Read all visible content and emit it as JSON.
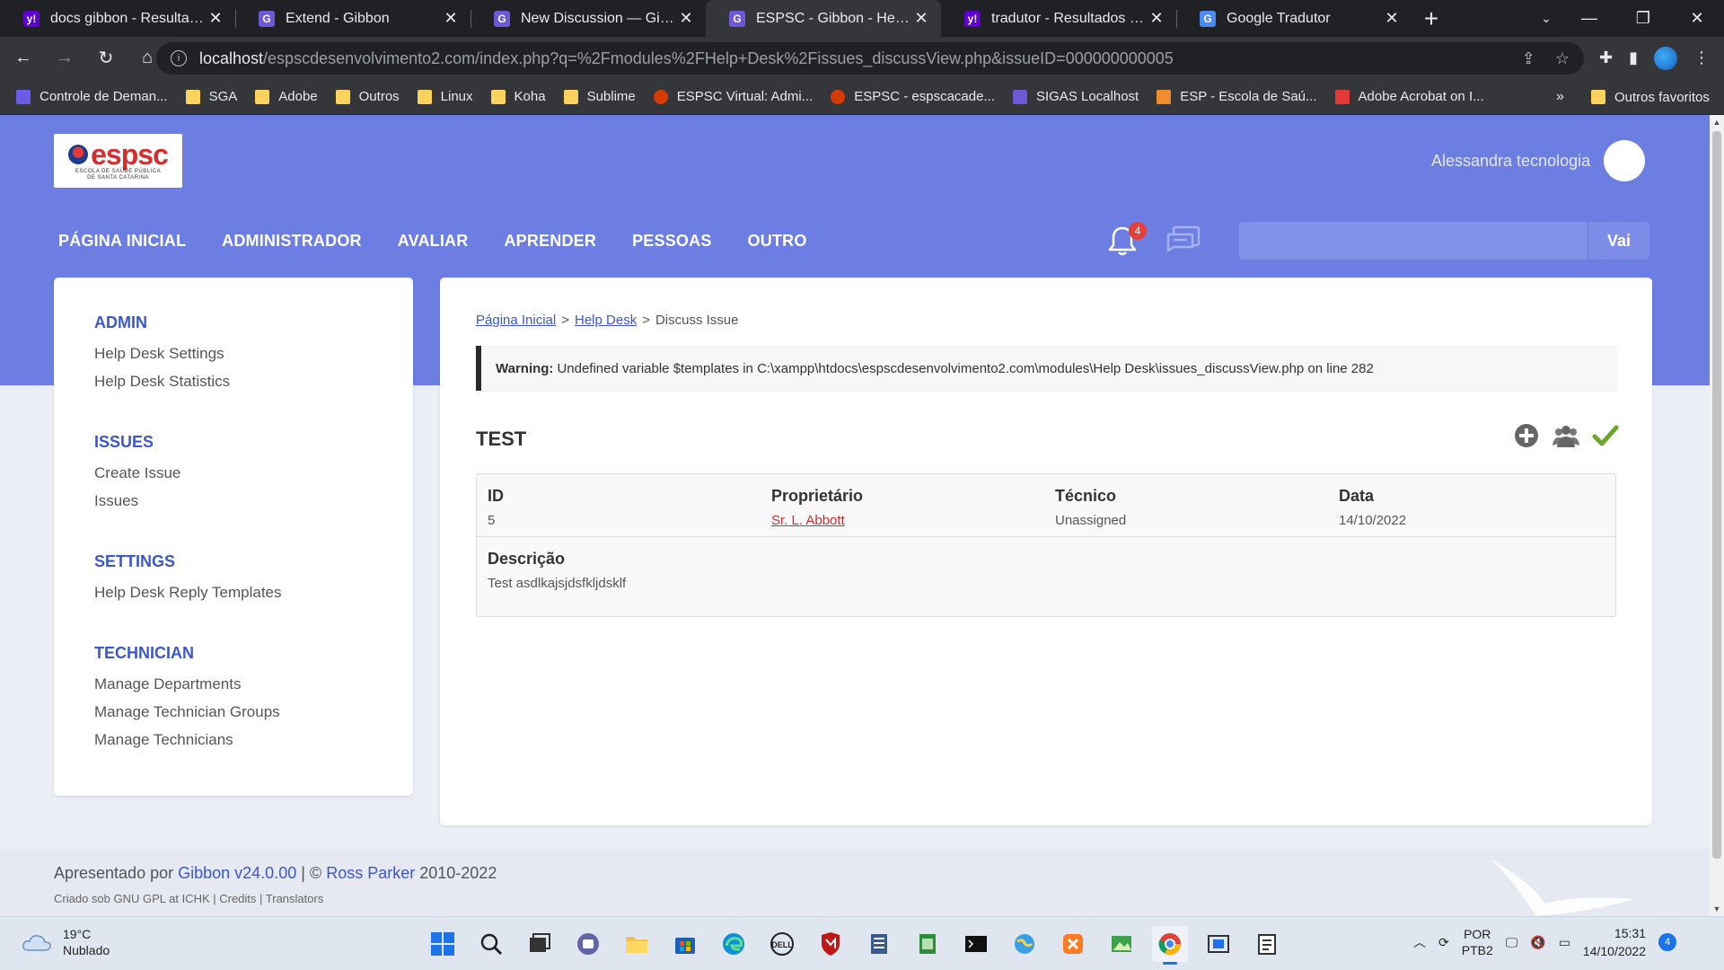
{
  "browser": {
    "tabs": [
      {
        "title": "docs gibbon - Resultados da busca",
        "favicon": "yahoo",
        "fav_label": "y!"
      },
      {
        "title": "Extend - Gibbon",
        "favicon": "gibbon",
        "fav_label": "G"
      },
      {
        "title": "New Discussion — Gibbon Forums",
        "favicon": "gibbon",
        "fav_label": "G"
      },
      {
        "title": "ESPSC - Gibbon - Help Desk",
        "favicon": "gibbon",
        "fav_label": "G",
        "active": true
      },
      {
        "title": "tradutor - Resultados da busca",
        "favicon": "yahoo",
        "fav_label": "y!"
      },
      {
        "title": "Google Tradutor",
        "favicon": "google-translate",
        "fav_label": "G"
      }
    ],
    "close_glyph": "✕",
    "newtab_glyph": "+",
    "url_host": "localhost",
    "url_path": "/espscdesenvolvimento2.com/index.php?q=%2Fmodules%2FHelp+Desk%2Fissues_discussView.php&issueID=000000000005",
    "bookmarks": [
      {
        "label": "Controle de Deman...",
        "icon": "list"
      },
      {
        "label": "SGA",
        "icon": "folder"
      },
      {
        "label": "Adobe",
        "icon": "folder"
      },
      {
        "label": "Outros",
        "icon": "folder"
      },
      {
        "label": "Linux",
        "icon": "folder"
      },
      {
        "label": "Koha",
        "icon": "folder"
      },
      {
        "label": "Sublime",
        "icon": "folder"
      },
      {
        "label": "ESPSC Virtual: Admi...",
        "icon": "hand"
      },
      {
        "label": "ESPSC - espscacade...",
        "icon": "hand"
      },
      {
        "label": "SIGAS Localhost",
        "icon": "gibbon"
      },
      {
        "label": "ESP - Escola de Saú...",
        "icon": "x-logo"
      },
      {
        "label": "Adobe Acrobat on I...",
        "icon": "pdf"
      }
    ],
    "bookmarks_more": "»",
    "other_bookmarks": "Outros favoritos"
  },
  "site": {
    "logo_text": "espsc",
    "logo_sub_1": "ESCOLA DE SAÚDE PÚBLICA",
    "logo_sub_2": "DE SANTA CATARINA",
    "user_name": "Alessandra tecnologia",
    "nav": [
      "PÁGINA INICIAL",
      "ADMINISTRADOR",
      "AVALIAR",
      "APRENDER",
      "PESSOAS",
      "OUTRO"
    ],
    "notifications_count": "4",
    "search_button": "Vai",
    "search_placeholder": ""
  },
  "sidebar": {
    "groups": [
      {
        "heading": "ADMIN",
        "items": [
          "Help Desk Settings",
          "Help Desk Statistics"
        ]
      },
      {
        "heading": "ISSUES",
        "items": [
          "Create Issue",
          "Issues"
        ]
      },
      {
        "heading": "SETTINGS",
        "items": [
          "Help Desk Reply Templates"
        ]
      },
      {
        "heading": "TECHNICIAN",
        "items": [
          "Manage Departments",
          "Manage Technician Groups",
          "Manage Technicians"
        ]
      }
    ]
  },
  "content": {
    "breadcrumb": [
      "Página Inicial",
      "Help Desk",
      "Discuss Issue"
    ],
    "breadcrumb_sep": ">",
    "warning_label": "Warning:",
    "warning_text": "Undefined variable $templates in C:\\xampp\\htdocs\\espscdesenvolvimento2.com\\modules\\Help Desk\\issues_discussView.php on line 282",
    "issue_title": "TEST",
    "fields": {
      "id_label": "ID",
      "id_value": "5",
      "owner_label": "Proprietário",
      "owner_value": "Sr. L. Abbott",
      "tech_label": "Técnico",
      "tech_value": "Unassigned",
      "date_label": "Data",
      "date_value": "14/10/2022",
      "desc_label": "Descrição",
      "desc_value": "Test asdlkajsjdsfkljdsklf"
    }
  },
  "footer": {
    "line1_prefix": "Apresentado por",
    "gibbon_version": "Gibbon v24.0.00",
    "line1_sep": "| ©",
    "author": "Ross Parker",
    "years": "2010-2022",
    "line2": "Criado sob GNU GPL at ICHK | Credits | Translators"
  },
  "taskbar": {
    "temperature": "19°C",
    "weather": "Nublado",
    "lang_1": "POR",
    "lang_2": "PTB2",
    "time": "15:31",
    "date": "14/10/2022",
    "notifications": "4"
  },
  "colors": {
    "hero": "#6d7ee3",
    "accent": "#3d57c8",
    "link_red": "#c53030",
    "badge_red": "#e53e3e",
    "check_green": "#6aa728"
  }
}
